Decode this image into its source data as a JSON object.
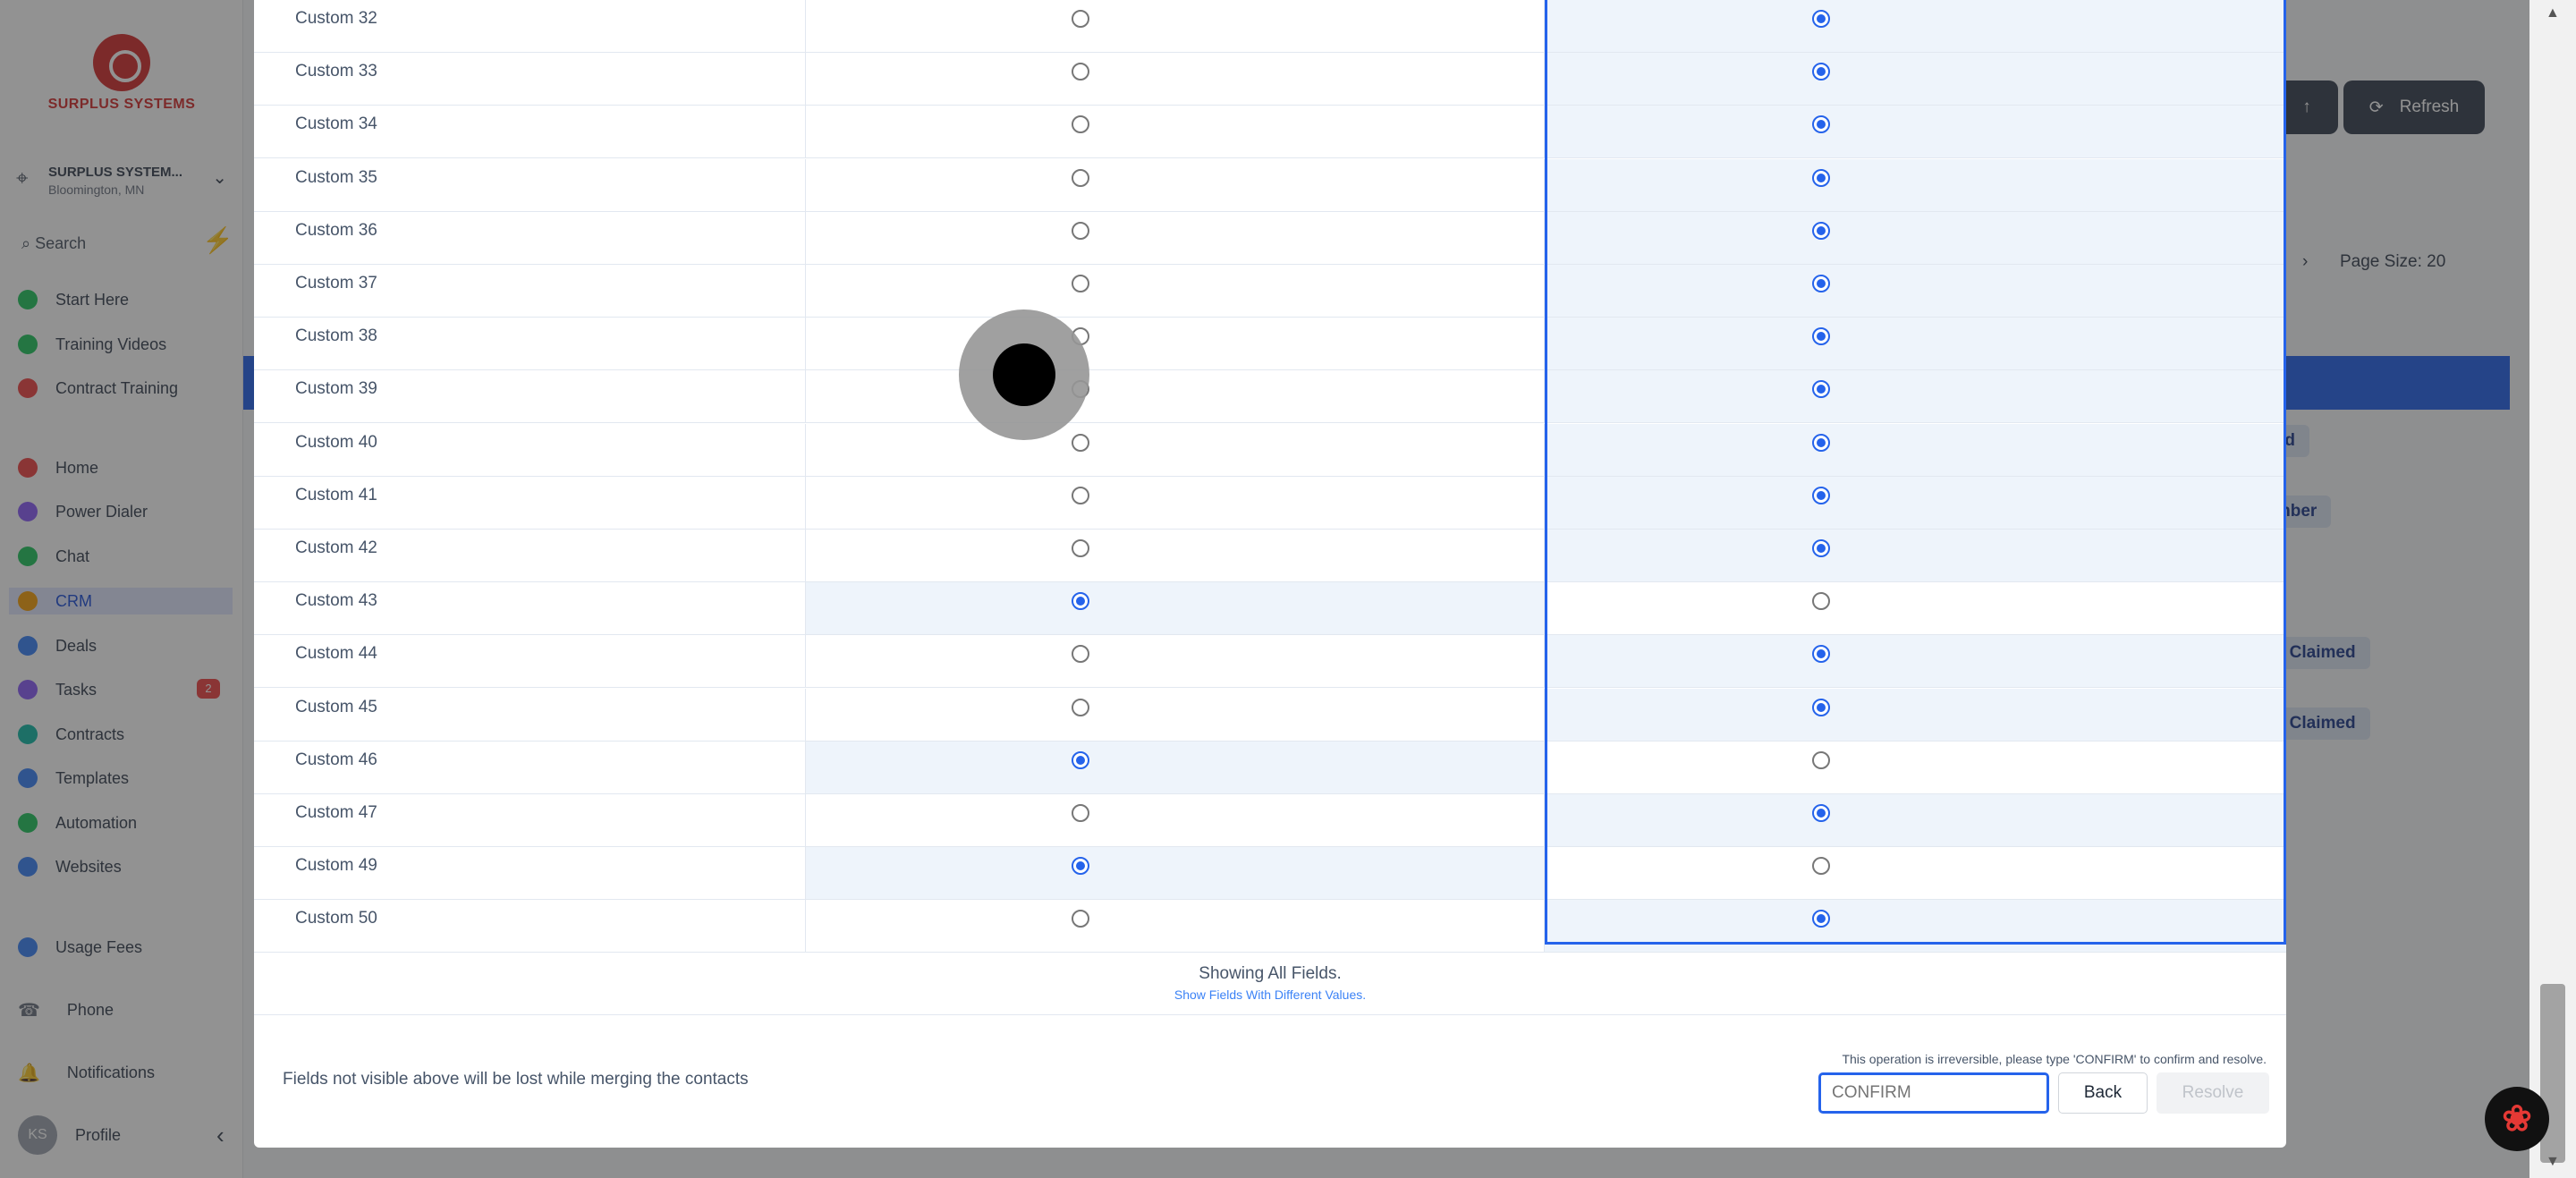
{
  "sidebar": {
    "logo_text": "SURPLUS SYSTEMS",
    "location_name": "SURPLUS SYSTEM...",
    "location_sub": "Bloomington, MN",
    "search_label": "Search",
    "items": [
      {
        "label": "Start Here",
        "color": "#22c55e"
      },
      {
        "label": "Training Videos",
        "color": "#22c55e"
      },
      {
        "label": "Contract Training",
        "color": "#ef4444"
      },
      {
        "label": "Home",
        "color": "#ef4444"
      },
      {
        "label": "Power Dialer",
        "color": "#8b5cf6"
      },
      {
        "label": "Chat",
        "color": "#22c55e"
      },
      {
        "label": "CRM",
        "color": "#f59e0b"
      },
      {
        "label": "Deals",
        "color": "#3b82f6"
      },
      {
        "label": "Tasks",
        "color": "#8b5cf6"
      },
      {
        "label": "Contracts",
        "color": "#14b8a6"
      },
      {
        "label": "Templates",
        "color": "#3b82f6"
      },
      {
        "label": "Automation",
        "color": "#22c55e"
      },
      {
        "label": "Websites",
        "color": "#3b82f6"
      },
      {
        "label": "Usage Fees",
        "color": "#3b82f6"
      }
    ],
    "tasks_badge": "2",
    "phone": "Phone",
    "notifications": "Notifications",
    "profile_initials": "KS",
    "profile": "Profile"
  },
  "main": {
    "refresh_label": "Refresh",
    "page_size": "Page Size: 20",
    "tags": [
      "...ad",
      "...mber",
      "...y Claimed",
      "...y Claimed"
    ]
  },
  "modal": {
    "rows": [
      {
        "label": "Custom 32",
        "selected": "right"
      },
      {
        "label": "Custom 33",
        "selected": "right"
      },
      {
        "label": "Custom 34",
        "selected": "right"
      },
      {
        "label": "Custom 35",
        "selected": "right"
      },
      {
        "label": "Custom 36",
        "selected": "right"
      },
      {
        "label": "Custom 37",
        "selected": "right"
      },
      {
        "label": "Custom 38",
        "selected": "right"
      },
      {
        "label": "Custom 39",
        "selected": "right"
      },
      {
        "label": "Custom 40",
        "selected": "right"
      },
      {
        "label": "Custom 41",
        "selected": "right"
      },
      {
        "label": "Custom 42",
        "selected": "right"
      },
      {
        "label": "Custom 43",
        "selected": "left"
      },
      {
        "label": "Custom 44",
        "selected": "right"
      },
      {
        "label": "Custom 45",
        "selected": "right"
      },
      {
        "label": "Custom 46",
        "selected": "left"
      },
      {
        "label": "Custom 47",
        "selected": "right"
      },
      {
        "label": "Custom 49",
        "selected": "left"
      },
      {
        "label": "Custom 50",
        "selected": "right"
      }
    ],
    "showing_text": "Showing All Fields.",
    "show_diff_link": "Show Fields With Different Values.",
    "warning_text": "Fields not visible above will be lost while merging the contacts",
    "irreversible_text": "This operation is irreversible, please type 'CONFIRM' to confirm and resolve.",
    "confirm_placeholder": "CONFIRM",
    "back_label": "Back",
    "resolve_label": "Resolve"
  }
}
